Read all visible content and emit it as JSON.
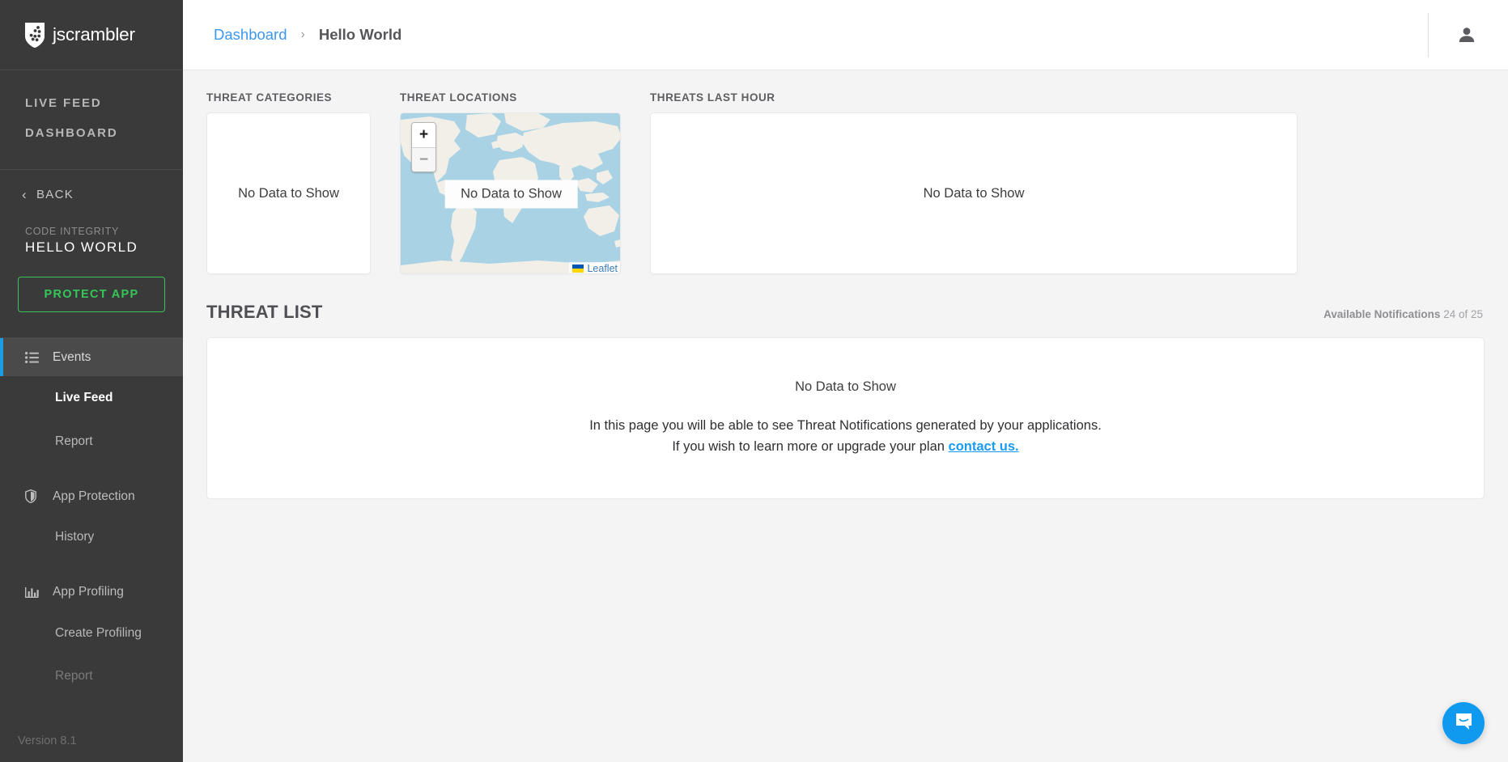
{
  "sidebar": {
    "brand": {
      "name": "jscrambler",
      "logo_icon": "jscrambler-shield-logo"
    },
    "top_nav": [
      {
        "label": "LIVE FEED",
        "name": "sidebar-link-live-feed"
      },
      {
        "label": "DASHBOARD",
        "name": "sidebar-link-dashboard"
      }
    ],
    "back": {
      "label": "BACK",
      "icon": "chevron-left-icon"
    },
    "app": {
      "kind": "CODE INTEGRITY",
      "title": "HELLO WORLD"
    },
    "protect_button": {
      "label": "PROTECT APP",
      "color": "#35c75a"
    },
    "groups": [
      {
        "label": "Events",
        "icon": "list-icon",
        "active": true,
        "items": [
          {
            "label": "Live Feed",
            "selected": true,
            "disabled": false
          },
          {
            "label": "Report",
            "selected": false,
            "disabled": false
          }
        ]
      },
      {
        "label": "App Protection",
        "icon": "shield-icon",
        "active": false,
        "items": [
          {
            "label": "History",
            "selected": false,
            "disabled": false
          }
        ]
      },
      {
        "label": "App Profiling",
        "icon": "bar-chart-icon",
        "active": false,
        "items": [
          {
            "label": "Create Profiling",
            "selected": false,
            "disabled": false
          },
          {
            "label": "Report",
            "selected": false,
            "disabled": true
          }
        ]
      }
    ],
    "version": "Version 8.1",
    "accent_active": "#1b9ce3",
    "background": "#3a3a3a"
  },
  "topbar": {
    "breadcrumb": {
      "root": "Dashboard",
      "separator": "›",
      "current": "Hello World",
      "link_color": "#3c97f0"
    },
    "account_icon": "user-avatar-icon"
  },
  "widgets": [
    {
      "title": "THREAT CATEGORIES",
      "empty_text": "No Data to Show",
      "name": "widget-threat-categories"
    },
    {
      "title": "THREAT LOCATIONS",
      "empty_text": "No Data to Show",
      "name": "widget-threat-locations"
    },
    {
      "title": "THREATS LAST HOUR",
      "empty_text": "No Data to Show",
      "name": "widget-threats-last-hour"
    }
  ],
  "map": {
    "zoom_in_label": "+",
    "zoom_out_label": "−",
    "empty_text": "No Data to Show",
    "attribution": "Leaflet",
    "flag_icon": "ukraine-flag-icon",
    "ocean_color": "#a9d3e4",
    "land_color": "#f2efe9"
  },
  "threat_list": {
    "title": "THREAT LIST",
    "notifications_label": "Available Notifications",
    "notifications_value": "24 of 25",
    "empty_title": "No Data to Show",
    "description_line1": "In this page you will be able to see Threat Notifications generated by your applications.",
    "description_line2_prefix": "If you wish to learn more or upgrade your plan ",
    "description_link": "contact us.",
    "link_color": "#1a9bf0"
  },
  "intercom": {
    "icon": "chat-bubble-smile-icon",
    "color": "#0f9af0"
  }
}
